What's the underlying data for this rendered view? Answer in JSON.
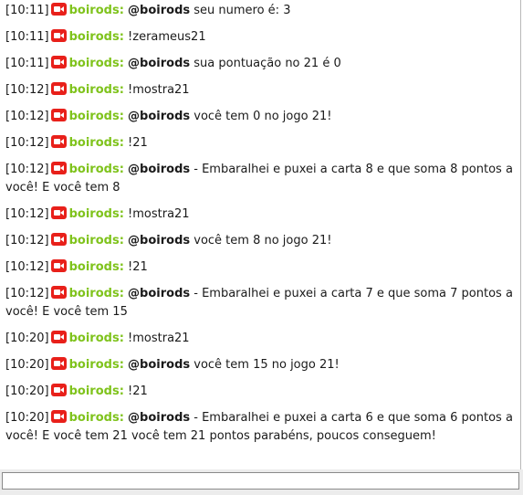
{
  "chat": {
    "messages": [
      {
        "time": "[10:11]",
        "user": "boirods:",
        "mention": "@boirods",
        "text": " seu numero é: 3"
      },
      {
        "time": "[10:11]",
        "user": "boirods:",
        "mention": "",
        "text": "!zerameus21"
      },
      {
        "time": "[10:11]",
        "user": "boirods:",
        "mention": "@boirods",
        "text": " sua pontuação no 21 é 0"
      },
      {
        "time": "[10:12]",
        "user": "boirods:",
        "mention": "",
        "text": "!mostra21"
      },
      {
        "time": "[10:12]",
        "user": "boirods:",
        "mention": "@boirods",
        "text": " você tem 0 no jogo 21!"
      },
      {
        "time": "[10:12]",
        "user": "boirods:",
        "mention": "",
        "text": "!21"
      },
      {
        "time": "[10:12]",
        "user": "boirods:",
        "mention": "@boirods",
        "text": " - Embaralhei e puxei a carta 8 e que soma 8 pontos a você! E você tem 8"
      },
      {
        "time": "[10:12]",
        "user": "boirods:",
        "mention": "",
        "text": "!mostra21"
      },
      {
        "time": "[10:12]",
        "user": "boirods:",
        "mention": "@boirods",
        "text": " você tem 8 no jogo 21!"
      },
      {
        "time": "[10:12]",
        "user": "boirods:",
        "mention": "",
        "text": "!21"
      },
      {
        "time": "[10:12]",
        "user": "boirods:",
        "mention": "@boirods",
        "text": " - Embaralhei e puxei a carta 7 e que soma 7 pontos a você! E você tem 15"
      },
      {
        "time": "[10:20]",
        "user": "boirods:",
        "mention": "",
        "text": "!mostra21"
      },
      {
        "time": "[10:20]",
        "user": "boirods:",
        "mention": "@boirods",
        "text": " você tem 15 no jogo 21!"
      },
      {
        "time": "[10:20]",
        "user": "boirods:",
        "mention": "",
        "text": "!21"
      },
      {
        "time": "[10:20]",
        "user": "boirods:",
        "mention": "@boirods",
        "text": " - Embaralhei e puxei a carta 6 e que soma 6 pontos a você! E você tem 21 você tem 21 pontos parabéns, poucos conseguem!"
      }
    ]
  },
  "input": {
    "value": "",
    "placeholder": ""
  },
  "colors": {
    "username": "#7fc31c",
    "camera_icon": "#e8201a"
  },
  "icons": {
    "badge": "video-camera-icon"
  }
}
